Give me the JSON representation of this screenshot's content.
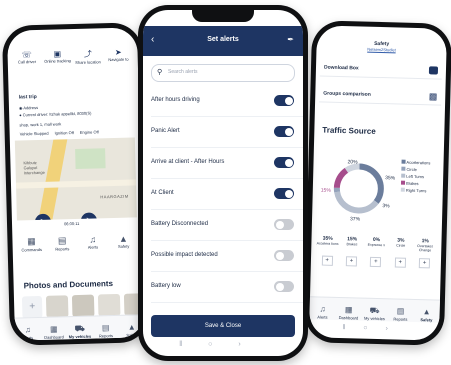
{
  "left": {
    "top_actions": [
      "Call driver",
      "Online tracking",
      "Share location",
      "Navigate to"
    ],
    "last_trip_title": "last trip",
    "address_label": "Address",
    "address_prefix": "Current driver: ",
    "driver_name": "Itzhak appellkt, 8030(S)",
    "trip_line": "shop, work 1, mall work",
    "badges": [
      "Vehicle Stopped",
      "Ignition Off",
      "Engine Off"
    ],
    "map_label": "HAARGAZIM",
    "map_label2": "Kibbutz Galuyot Interchange",
    "playback_time": "06:00:11",
    "grid": [
      "Commands",
      "Reports",
      "Alerts",
      "Safety"
    ],
    "photos_title": "Photos and Documents",
    "bottom_nav": [
      "Alerts",
      "Dashboard",
      "My vehicles",
      "Reports",
      "Safety"
    ]
  },
  "center": {
    "header_title": "Set alerts",
    "back_icon": "back-arrow-icon",
    "search_placeholder": "Search alerts",
    "alerts": [
      {
        "label": "After hours driving",
        "on": true
      },
      {
        "label": "Panic Alert",
        "on": true
      },
      {
        "label": "Arrive at client - After Hours",
        "on": true
      },
      {
        "label": "At Client",
        "on": true
      },
      {
        "label": "Battery Disconnected",
        "on": false
      },
      {
        "label": "Possible impact detected",
        "on": false
      },
      {
        "label": "Battery low",
        "on": false
      }
    ],
    "save_button": "Save & Close",
    "accent": "#1e3563"
  },
  "right": {
    "header_title": "Safety",
    "header_subtitle": "Netsem2Studiet",
    "menu": [
      "Download Box",
      "Groups comparison"
    ],
    "traffic_title": "Traffic Source",
    "donut_labels": [
      "20%",
      "35%",
      "15%",
      "37%",
      "3%"
    ],
    "legend": [
      {
        "label": "Accelerations",
        "color": "#6b7d9c"
      },
      {
        "label": "Circle",
        "color": "#95a3bb"
      },
      {
        "label": "Left Turns",
        "color": "#b6bfce"
      },
      {
        "label": "Brakes",
        "color": "#a64d8c"
      },
      {
        "label": "Right Turns",
        "color": "#cfd5df"
      }
    ],
    "stats": [
      {
        "value": "35%",
        "label": "Accelera tions"
      },
      {
        "value": "15%",
        "label": "Brakes"
      },
      {
        "value": "0%",
        "label": "Expresse s"
      },
      {
        "value": "3%",
        "label": "Circle"
      },
      {
        "value": "1%",
        "label": "Overtakes Change"
      }
    ],
    "bottom_nav": [
      "Alerts",
      "Dashboard",
      "My vehicles",
      "Reports",
      "Safety"
    ]
  }
}
